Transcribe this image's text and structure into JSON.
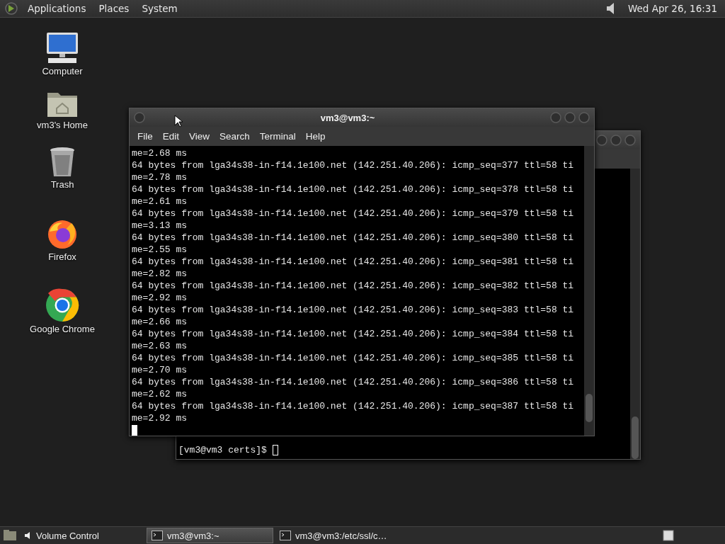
{
  "top_panel": {
    "menus": [
      {
        "label": "Applications"
      },
      {
        "label": "Places"
      },
      {
        "label": "System"
      }
    ],
    "clock": "Wed Apr 26, 16:31"
  },
  "desktop_icons": [
    {
      "kind": "computer",
      "label": "Computer"
    },
    {
      "kind": "home",
      "label": "vm3's Home"
    },
    {
      "kind": "trash",
      "label": "Trash"
    },
    {
      "kind": "firefox",
      "label": "Firefox"
    },
    {
      "kind": "chrome",
      "label": "Google Chrome"
    }
  ],
  "back_window": {
    "lines": [
      {
        "kind": "prompt",
        "text": "[vm3@vm3 certs]$ "
      }
    ]
  },
  "front_window": {
    "title": "vm3@vm3:~",
    "menu": [
      {
        "label": "File"
      },
      {
        "label": "Edit"
      },
      {
        "label": "View"
      },
      {
        "label": "Search"
      },
      {
        "label": "Terminal"
      },
      {
        "label": "Help"
      }
    ],
    "lines": [
      "me=2.68 ms",
      "64 bytes from lga34s38-in-f14.1e100.net (142.251.40.206): icmp_seq=377 ttl=58 ti",
      "me=2.78 ms",
      "64 bytes from lga34s38-in-f14.1e100.net (142.251.40.206): icmp_seq=378 ttl=58 ti",
      "me=2.61 ms",
      "64 bytes from lga34s38-in-f14.1e100.net (142.251.40.206): icmp_seq=379 ttl=58 ti",
      "me=3.13 ms",
      "64 bytes from lga34s38-in-f14.1e100.net (142.251.40.206): icmp_seq=380 ttl=58 ti",
      "me=2.55 ms",
      "64 bytes from lga34s38-in-f14.1e100.net (142.251.40.206): icmp_seq=381 ttl=58 ti",
      "me=2.82 ms",
      "64 bytes from lga34s38-in-f14.1e100.net (142.251.40.206): icmp_seq=382 ttl=58 ti",
      "me=2.92 ms",
      "64 bytes from lga34s38-in-f14.1e100.net (142.251.40.206): icmp_seq=383 ttl=58 ti",
      "me=2.66 ms",
      "64 bytes from lga34s38-in-f14.1e100.net (142.251.40.206): icmp_seq=384 ttl=58 ti",
      "me=2.63 ms",
      "64 bytes from lga34s38-in-f14.1e100.net (142.251.40.206): icmp_seq=385 ttl=58 ti",
      "me=2.70 ms",
      "64 bytes from lga34s38-in-f14.1e100.net (142.251.40.206): icmp_seq=386 ttl=58 ti",
      "me=2.62 ms",
      "64 bytes from lga34s38-in-f14.1e100.net (142.251.40.206): icmp_seq=387 ttl=58 ti",
      "me=2.92 ms"
    ]
  },
  "taskbar": {
    "items": [
      {
        "kind": "app",
        "label": "Volume Control",
        "selected": false
      },
      {
        "kind": "terminal",
        "label": "vm3@vm3:~",
        "selected": true
      },
      {
        "kind": "terminal",
        "label": "vm3@vm3:/etc/ssl/c…",
        "selected": false
      }
    ]
  }
}
